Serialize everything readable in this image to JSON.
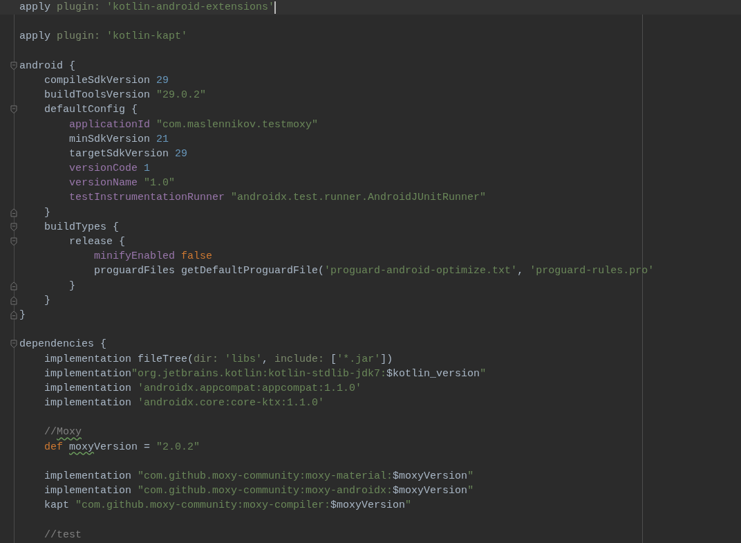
{
  "blocks": [
    [
      {
        "current": true,
        "fold_start": false,
        "fold_end": false,
        "tokens": [
          {
            "text": "apply ",
            "kind": "plain"
          },
          {
            "text": "plugin: ",
            "kind": "param"
          },
          {
            "text": "'kotlin-android-extensions'",
            "kind": "string"
          }
        ]
      }
    ],
    [
      {
        "current": false,
        "fold_start": false,
        "fold_end": false,
        "tokens": [
          {
            "text": "apply ",
            "kind": "plain"
          },
          {
            "text": "plugin: ",
            "kind": "param"
          },
          {
            "text": "'kotlin-kapt'",
            "kind": "string"
          }
        ]
      }
    ],
    [
      {
        "current": false,
        "fold_start": true,
        "fold_end": false,
        "tokens": [
          {
            "text": "android {",
            "kind": "plain"
          }
        ]
      },
      {
        "current": false,
        "fold_start": false,
        "fold_end": false,
        "tokens": [
          {
            "text": "    compileSdkVersion ",
            "kind": "plain"
          },
          {
            "text": "29",
            "kind": "number"
          }
        ]
      },
      {
        "current": false,
        "fold_start": false,
        "fold_end": false,
        "tokens": [
          {
            "text": "    buildToolsVersion ",
            "kind": "plain"
          },
          {
            "text": "\"29.0.2\"",
            "kind": "string"
          }
        ]
      },
      {
        "current": false,
        "fold_start": true,
        "fold_end": false,
        "tokens": [
          {
            "text": "    defaultConfig {",
            "kind": "plain"
          }
        ]
      },
      {
        "current": false,
        "fold_start": false,
        "fold_end": false,
        "tokens": [
          {
            "text": "        applicationId ",
            "kind": "property"
          },
          {
            "text": "\"com.maslennikov.testmoxy\"",
            "kind": "string"
          }
        ]
      },
      {
        "current": false,
        "fold_start": false,
        "fold_end": false,
        "tokens": [
          {
            "text": "        minSdkVersion ",
            "kind": "plain"
          },
          {
            "text": "21",
            "kind": "number"
          }
        ]
      },
      {
        "current": false,
        "fold_start": false,
        "fold_end": false,
        "tokens": [
          {
            "text": "        targetSdkVersion ",
            "kind": "plain"
          },
          {
            "text": "29",
            "kind": "number"
          }
        ]
      },
      {
        "current": false,
        "fold_start": false,
        "fold_end": false,
        "tokens": [
          {
            "text": "        versionCode ",
            "kind": "property"
          },
          {
            "text": "1",
            "kind": "number"
          }
        ]
      },
      {
        "current": false,
        "fold_start": false,
        "fold_end": false,
        "tokens": [
          {
            "text": "        versionName ",
            "kind": "property"
          },
          {
            "text": "\"1.0\"",
            "kind": "string"
          }
        ]
      },
      {
        "current": false,
        "fold_start": false,
        "fold_end": false,
        "tokens": [
          {
            "text": "        testInstrumentationRunner ",
            "kind": "property"
          },
          {
            "text": "\"androidx.test.runner.AndroidJUnitRunner\"",
            "kind": "string"
          }
        ]
      },
      {
        "current": false,
        "fold_start": false,
        "fold_end": true,
        "tokens": [
          {
            "text": "    }",
            "kind": "plain"
          }
        ]
      },
      {
        "current": false,
        "fold_start": true,
        "fold_end": false,
        "tokens": [
          {
            "text": "    buildTypes {",
            "kind": "plain"
          }
        ]
      },
      {
        "current": false,
        "fold_start": true,
        "fold_end": false,
        "tokens": [
          {
            "text": "        release {",
            "kind": "plain"
          }
        ]
      },
      {
        "current": false,
        "fold_start": false,
        "fold_end": false,
        "tokens": [
          {
            "text": "            minifyEnabled ",
            "kind": "property"
          },
          {
            "text": "false",
            "kind": "keyword"
          }
        ]
      },
      {
        "current": false,
        "fold_start": false,
        "fold_end": false,
        "tokens": [
          {
            "text": "            proguardFiles getDefaultProguardFile(",
            "kind": "plain"
          },
          {
            "text": "'proguard-android-optimize.txt'",
            "kind": "string"
          },
          {
            "text": ", ",
            "kind": "plain"
          },
          {
            "text": "'proguard-rules.pro'",
            "kind": "string"
          }
        ]
      },
      {
        "current": false,
        "fold_start": false,
        "fold_end": true,
        "tokens": [
          {
            "text": "        }",
            "kind": "plain"
          }
        ]
      },
      {
        "current": false,
        "fold_start": false,
        "fold_end": true,
        "tokens": [
          {
            "text": "    }",
            "kind": "plain"
          }
        ]
      },
      {
        "current": false,
        "fold_start": false,
        "fold_end": true,
        "tokens": [
          {
            "text": "}",
            "kind": "plain"
          }
        ]
      }
    ],
    [
      {
        "current": false,
        "fold_start": true,
        "fold_end": false,
        "tokens": [
          {
            "text": "dependencies {",
            "kind": "plain"
          }
        ]
      },
      {
        "current": false,
        "fold_start": false,
        "fold_end": false,
        "tokens": [
          {
            "text": "    implementation fileTree(",
            "kind": "plain"
          },
          {
            "text": "dir: ",
            "kind": "param"
          },
          {
            "text": "'libs'",
            "kind": "string"
          },
          {
            "text": ", ",
            "kind": "plain"
          },
          {
            "text": "include: ",
            "kind": "param"
          },
          {
            "text": "[",
            "kind": "plain"
          },
          {
            "text": "'*.jar'",
            "kind": "string"
          },
          {
            "text": "])",
            "kind": "plain"
          }
        ]
      },
      {
        "current": false,
        "fold_start": false,
        "fold_end": false,
        "tokens": [
          {
            "text": "    implementation",
            "kind": "plain"
          },
          {
            "text": "\"org.jetbrains.kotlin:kotlin-stdlib-jdk7:",
            "kind": "string"
          },
          {
            "text": "$kotlin_version",
            "kind": "plain"
          },
          {
            "text": "\"",
            "kind": "string"
          }
        ]
      },
      {
        "current": false,
        "fold_start": false,
        "fold_end": false,
        "tokens": [
          {
            "text": "    implementation ",
            "kind": "plain"
          },
          {
            "text": "'androidx.appcompat:appcompat:1.1.0'",
            "kind": "string"
          }
        ]
      },
      {
        "current": false,
        "fold_start": false,
        "fold_end": false,
        "tokens": [
          {
            "text": "    implementation ",
            "kind": "plain"
          },
          {
            "text": "'androidx.core:core-ktx:1.1.0'",
            "kind": "string"
          }
        ]
      }
    ],
    [
      {
        "current": false,
        "fold_start": false,
        "fold_end": false,
        "tokens": [
          {
            "text": "    //",
            "kind": "comment"
          },
          {
            "text": "Moxy",
            "kind": "comment",
            "typo": true
          }
        ]
      },
      {
        "current": false,
        "fold_start": false,
        "fold_end": false,
        "tokens": [
          {
            "text": "    def ",
            "kind": "keyword"
          },
          {
            "text": "moxy",
            "kind": "plain",
            "typo": true
          },
          {
            "text": "Version = ",
            "kind": "plain"
          },
          {
            "text": "\"2.0.2\"",
            "kind": "string"
          }
        ]
      }
    ],
    [
      {
        "current": false,
        "fold_start": false,
        "fold_end": false,
        "tokens": [
          {
            "text": "    implementation ",
            "kind": "plain"
          },
          {
            "text": "\"com.github.moxy-community:moxy-material:",
            "kind": "string"
          },
          {
            "text": "$moxyVersion",
            "kind": "plain"
          },
          {
            "text": "\"",
            "kind": "string"
          }
        ]
      },
      {
        "current": false,
        "fold_start": false,
        "fold_end": false,
        "tokens": [
          {
            "text": "    implementation ",
            "kind": "plain"
          },
          {
            "text": "\"com.github.moxy-community:moxy-androidx:",
            "kind": "string"
          },
          {
            "text": "$moxyVersion",
            "kind": "plain"
          },
          {
            "text": "\"",
            "kind": "string"
          }
        ]
      },
      {
        "current": false,
        "fold_start": false,
        "fold_end": false,
        "tokens": [
          {
            "text": "    kapt ",
            "kind": "plain"
          },
          {
            "text": "\"com.github.moxy-community:moxy-compiler:",
            "kind": "string"
          },
          {
            "text": "$moxyVersion",
            "kind": "plain"
          },
          {
            "text": "\"",
            "kind": "string"
          }
        ]
      }
    ],
    [
      {
        "current": false,
        "fold_start": false,
        "fold_end": false,
        "tokens": [
          {
            "text": "    //test",
            "kind": "comment"
          }
        ]
      }
    ]
  ]
}
